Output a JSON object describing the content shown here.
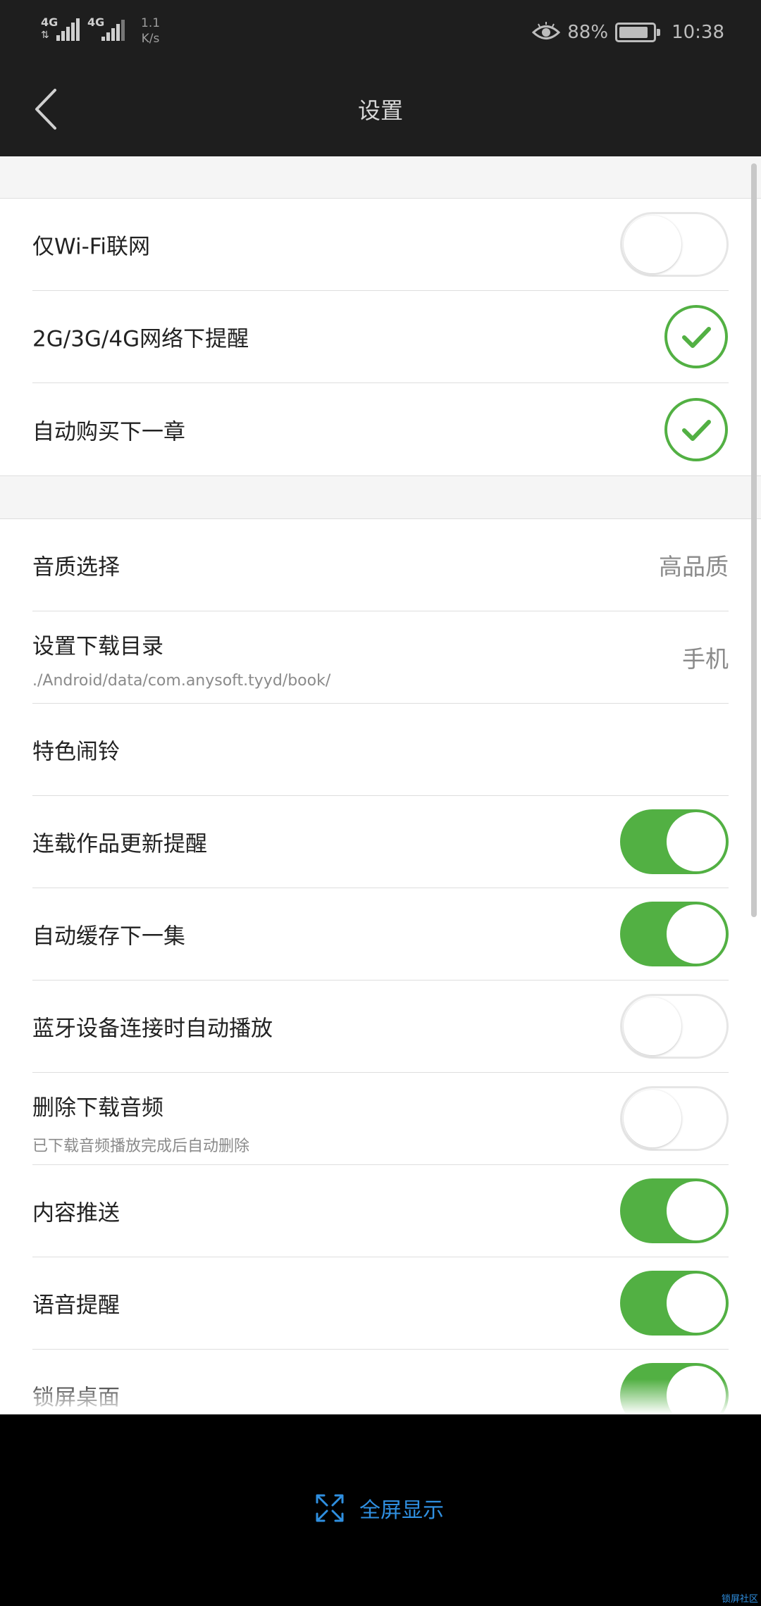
{
  "status_bar": {
    "network_1": "4G",
    "network_2": "4G",
    "speed_value": "1.1",
    "speed_unit": "K/s",
    "battery_percent": "88%",
    "battery_level": 0.88,
    "time": "10:38"
  },
  "app_bar": {
    "title": "设置"
  },
  "section_1": {
    "wifi_only": {
      "label": "仅Wi-Fi联网",
      "state": "off"
    },
    "mobile_network_alert": {
      "label": "2G/3G/4G网络下提醒",
      "state": "checked"
    },
    "auto_buy_next": {
      "label": "自动购买下一章",
      "state": "checked"
    }
  },
  "section_2": {
    "audio_quality": {
      "label": "音质选择",
      "value": "高品质"
    },
    "download_dir": {
      "label": "设置下载目录",
      "path": "./Android/data/com.anysoft.tyyd/book/",
      "value": "手机"
    },
    "alarm": {
      "label": "特色闹铃"
    },
    "serial_update": {
      "label": "连载作品更新提醒",
      "state": "on"
    },
    "auto_cache": {
      "label": "自动缓存下一集",
      "state": "on"
    },
    "bluetooth_autoplay": {
      "label": "蓝牙设备连接时自动播放",
      "state": "off"
    },
    "delete_download": {
      "label": "删除下载音频",
      "sub": "已下载音频播放完成后自动删除",
      "state": "off"
    },
    "content_push": {
      "label": "内容推送",
      "state": "on"
    },
    "voice_alert": {
      "label": "语音提醒",
      "state": "on"
    },
    "lock_screen": {
      "label": "锁屏桌面",
      "state": "on"
    }
  },
  "bottom_bar": {
    "fullscreen_label": "全屏显示",
    "watermark": "锁屏社区"
  },
  "colors": {
    "accent_green": "#52b043",
    "link_blue": "#2f8fe0",
    "bar_dark": "#1e1e1e"
  }
}
